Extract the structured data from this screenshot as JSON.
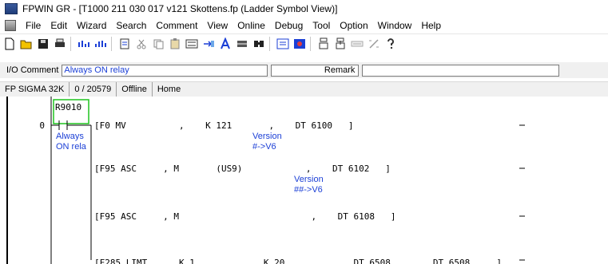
{
  "window": {
    "title": "FPWIN GR - [T1000 211 030 017 v121 Skottens.fp (Ladder Symbol View)]"
  },
  "menu": {
    "items": [
      "File",
      "Edit",
      "Wizard",
      "Search",
      "Comment",
      "View",
      "Online",
      "Debug",
      "Tool",
      "Option",
      "Window",
      "Help"
    ]
  },
  "toolbar": {
    "icons": [
      "new-icon",
      "open-icon",
      "save-icon",
      "print-icon",
      "ladder-icon",
      "ladder2-icon",
      "program-icon",
      "cut-icon",
      "copy-icon",
      "paste-icon",
      "convert-icon",
      "convert-arrow-icon",
      "text-icon",
      "block-icon",
      "find-icon",
      "monitor-icon",
      "view-icon",
      "plc-read-icon",
      "plc-write-icon",
      "run-icon",
      "step-icon",
      "help-icon"
    ]
  },
  "comment_bar": {
    "label": "I/O Comment",
    "value": "Always ON relay",
    "remark_label": "Remark"
  },
  "status": {
    "plc": "FP SIGMA 32K",
    "steps": "0 / 20579",
    "mode": "Offline",
    "position": "Home"
  },
  "ladder": {
    "step": "0",
    "contact_address": "R9010",
    "contact_comment": [
      "Always",
      "ON rela"
    ],
    "rows": [
      {
        "text": "[F0 MV          ,    K 121       ,    DT 6100   ]",
        "comment": [
          "Version",
          "#->V6"
        ]
      },
      {
        "text": "[F95 ASC     , M       (US9)            ,    DT 6102   ]",
        "comment": [
          "Version",
          "##->V6"
        ]
      },
      {
        "text": "[F95 ASC     , M                         ,    DT 6108   ]",
        "comment": []
      },
      {
        "text": "[F285 LIMT      K 1             K 20             DT 6508        DT 6508     ]",
        "comment": []
      }
    ]
  }
}
